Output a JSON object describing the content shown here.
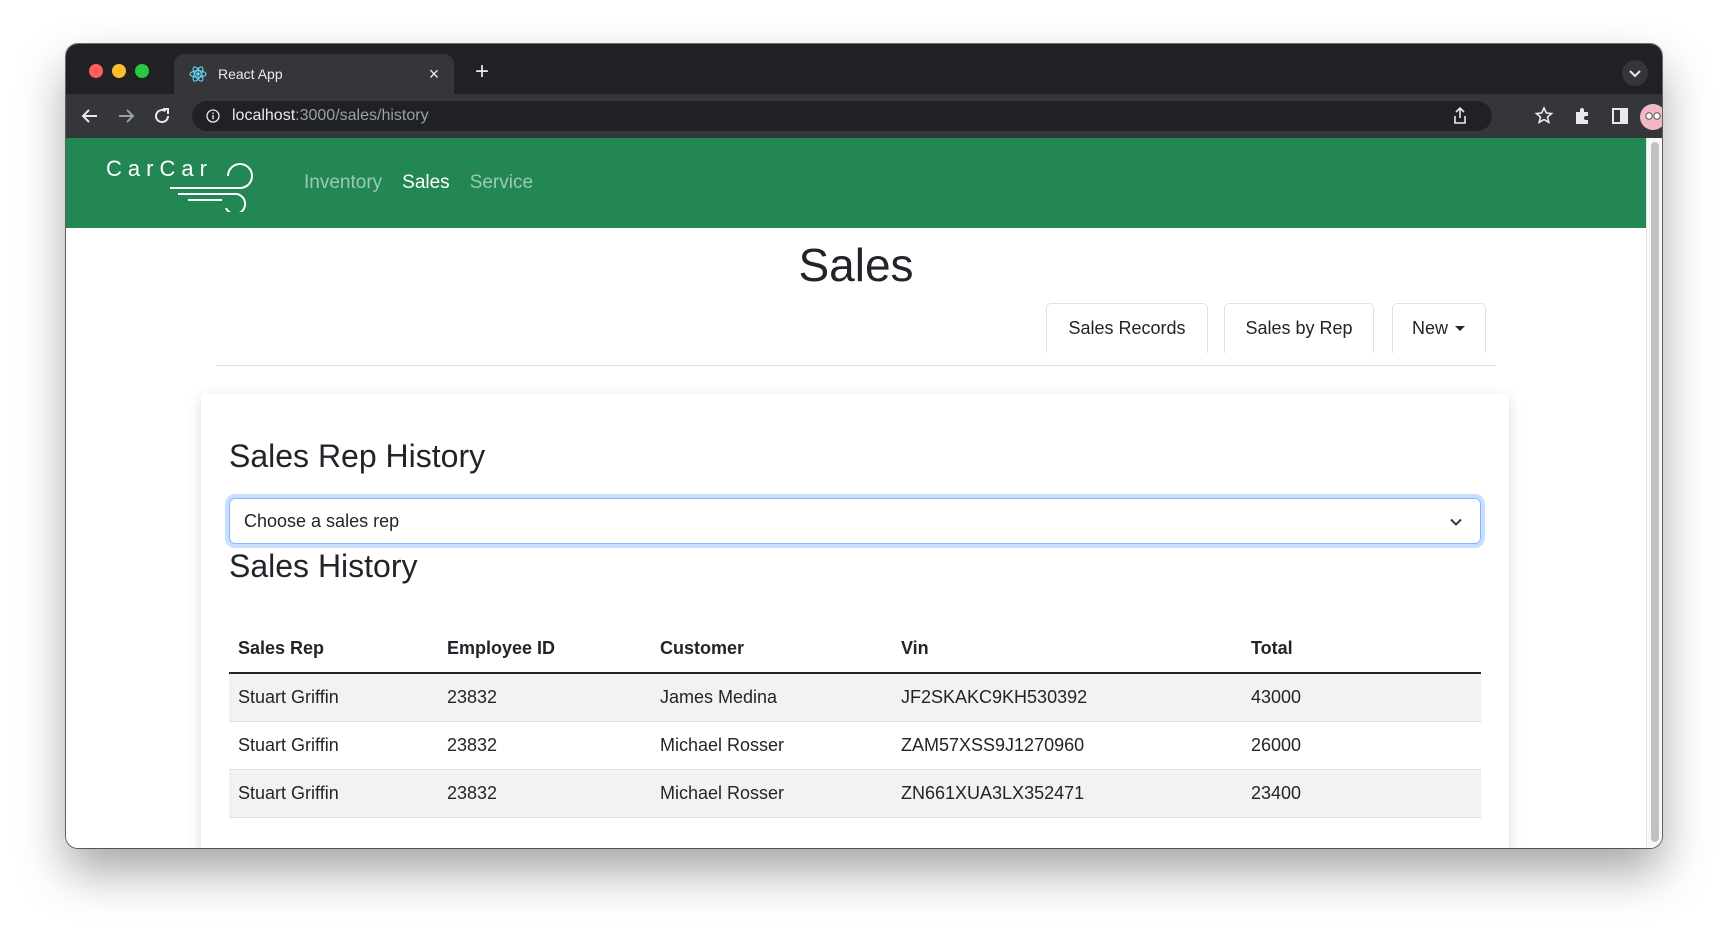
{
  "browser": {
    "tab_title": "React App",
    "tab_close_glyph": "×",
    "new_tab_glyph": "+",
    "url_host": "localhost",
    "url_path": ":3000/sales/history",
    "icons": [
      "react-favicon-icon",
      "back-icon",
      "forward-icon",
      "reload-icon",
      "info-icon",
      "share-icon",
      "star-icon",
      "extensions-icon",
      "sidepanel-icon",
      "profile-avatar",
      "more-icon",
      "tab-search-icon"
    ]
  },
  "navbar": {
    "brand": "CarCar",
    "links": [
      "Inventory",
      "Sales",
      "Service"
    ],
    "active_link": "Sales",
    "color": "#228752"
  },
  "page": {
    "title": "Sales",
    "subnav": {
      "records_label": "Sales Records",
      "by_rep_label": "Sales by Rep",
      "new_label": "New"
    }
  },
  "rep_history": {
    "heading": "Sales Rep History",
    "select_value": "Choose a sales rep"
  },
  "sales_history": {
    "heading": "Sales History",
    "columns": [
      "Sales Rep",
      "Employee ID",
      "Customer",
      "Vin",
      "Total"
    ],
    "rows": [
      [
        "Stuart Griffin",
        "23832",
        "James Medina",
        "JF2SKAKC9KH530392",
        "43000"
      ],
      [
        "Stuart Griffin",
        "23832",
        "Michael Rosser",
        "ZAM57XSS9J1270960",
        "26000"
      ],
      [
        "Stuart Griffin",
        "23832",
        "Michael Rosser",
        "ZN661XUA3LX352471",
        "23400"
      ]
    ]
  }
}
